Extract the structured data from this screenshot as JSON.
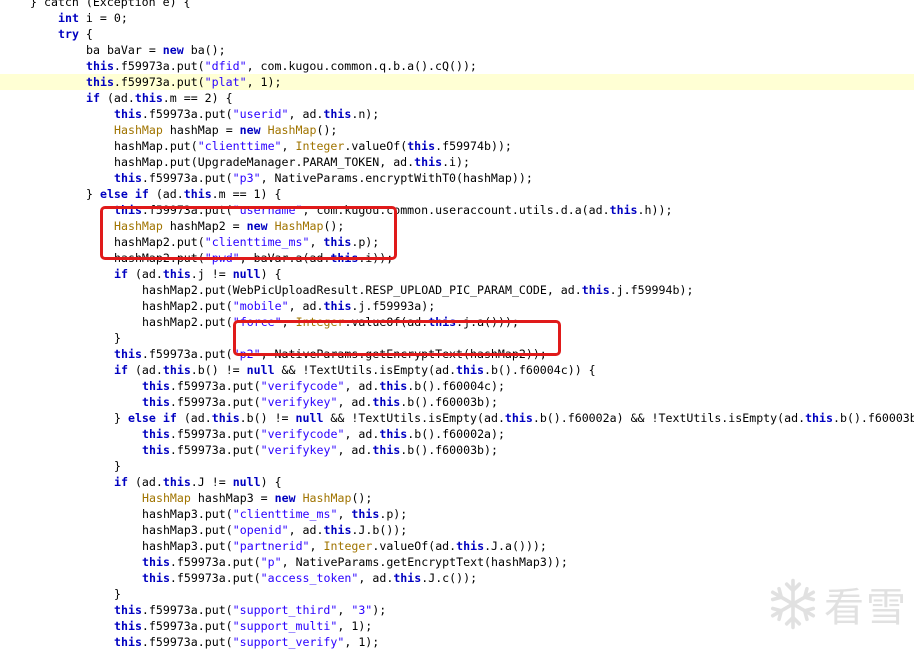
{
  "colors": {
    "keyword": "#0000c0",
    "type": "#a07400",
    "string": "#2a00ff",
    "highlight_line": "#ffffd4",
    "annotation_box": "#e01a1a"
  },
  "code_lines": [
    {
      "indent": 0,
      "hl": false,
      "tokens": [
        [
          "n",
          "} catch (Exception e) {"
        ]
      ]
    },
    {
      "indent": 1,
      "hl": false,
      "tokens": [
        [
          "k",
          "int"
        ],
        [
          "n",
          " i = 0;"
        ]
      ]
    },
    {
      "indent": 1,
      "hl": false,
      "tokens": [
        [
          "k",
          "try"
        ],
        [
          "n",
          " {"
        ]
      ]
    },
    {
      "indent": 2,
      "hl": false,
      "tokens": [
        [
          "n",
          "ba baVar = "
        ],
        [
          "k",
          "new"
        ],
        [
          "n",
          " ba();"
        ]
      ]
    },
    {
      "indent": 2,
      "hl": false,
      "tokens": [
        [
          "k",
          "this"
        ],
        [
          "n",
          ".f59973a.put("
        ],
        [
          "s",
          "\"dfid\""
        ],
        [
          "n",
          ", com.kugou.common.q.b.a().cQ());"
        ]
      ]
    },
    {
      "indent": 2,
      "hl": true,
      "tokens": [
        [
          "k",
          "this"
        ],
        [
          "n",
          ".f59973a.put("
        ],
        [
          "s",
          "\"plat\""
        ],
        [
          "n",
          ", 1);"
        ]
      ]
    },
    {
      "indent": 2,
      "hl": false,
      "tokens": [
        [
          "k",
          "if"
        ],
        [
          "n",
          " (ad."
        ],
        [
          "k",
          "this"
        ],
        [
          "n",
          ".m == 2) {"
        ]
      ]
    },
    {
      "indent": 3,
      "hl": false,
      "tokens": [
        [
          "k",
          "this"
        ],
        [
          "n",
          ".f59973a.put("
        ],
        [
          "s",
          "\"userid\""
        ],
        [
          "n",
          ", ad."
        ],
        [
          "k",
          "this"
        ],
        [
          "n",
          ".n);"
        ]
      ]
    },
    {
      "indent": 3,
      "hl": false,
      "tokens": [
        [
          "t",
          "HashMap"
        ],
        [
          "n",
          " hashMap = "
        ],
        [
          "k",
          "new"
        ],
        [
          "n",
          " "
        ],
        [
          "t",
          "HashMap"
        ],
        [
          "n",
          "();"
        ]
      ]
    },
    {
      "indent": 3,
      "hl": false,
      "tokens": [
        [
          "n",
          "hashMap.put("
        ],
        [
          "s",
          "\"clienttime\""
        ],
        [
          "n",
          ", "
        ],
        [
          "t",
          "Integer"
        ],
        [
          "n",
          ".valueOf("
        ],
        [
          "k",
          "this"
        ],
        [
          "n",
          ".f59974b));"
        ]
      ]
    },
    {
      "indent": 3,
      "hl": false,
      "tokens": [
        [
          "n",
          "hashMap.put(UpgradeManager.PARAM_TOKEN, ad."
        ],
        [
          "k",
          "this"
        ],
        [
          "n",
          ".i);"
        ]
      ]
    },
    {
      "indent": 3,
      "hl": false,
      "tokens": [
        [
          "k",
          "this"
        ],
        [
          "n",
          ".f59973a.put("
        ],
        [
          "s",
          "\"p3\""
        ],
        [
          "n",
          ", NativeParams.encryptWithT0(hashMap));"
        ]
      ]
    },
    {
      "indent": 2,
      "hl": false,
      "tokens": [
        [
          "n",
          "} "
        ],
        [
          "k",
          "else if"
        ],
        [
          "n",
          " (ad."
        ],
        [
          "k",
          "this"
        ],
        [
          "n",
          ".m == 1) {"
        ]
      ]
    },
    {
      "indent": 3,
      "hl": false,
      "tokens": [
        [
          "k",
          "this"
        ],
        [
          "n",
          ".f59973a.put("
        ],
        [
          "s",
          "\"username\""
        ],
        [
          "n",
          ", com.kugou.common.useraccount.utils.d.a(ad."
        ],
        [
          "k",
          "this"
        ],
        [
          "n",
          ".h));"
        ]
      ]
    },
    {
      "indent": 3,
      "hl": false,
      "tokens": [
        [
          "t",
          "HashMap"
        ],
        [
          "n",
          " hashMap2 = "
        ],
        [
          "k",
          "new"
        ],
        [
          "n",
          " "
        ],
        [
          "t",
          "HashMap"
        ],
        [
          "n",
          "();"
        ]
      ]
    },
    {
      "indent": 3,
      "hl": false,
      "tokens": [
        [
          "n",
          "hashMap2.put("
        ],
        [
          "s",
          "\"clienttime_ms\""
        ],
        [
          "n",
          ", "
        ],
        [
          "k",
          "this"
        ],
        [
          "n",
          ".p);"
        ]
      ]
    },
    {
      "indent": 3,
      "hl": false,
      "tokens": [
        [
          "n",
          "hashMap2.put("
        ],
        [
          "s",
          "\"pwd\""
        ],
        [
          "n",
          ", baVar.a(ad."
        ],
        [
          "k",
          "this"
        ],
        [
          "n",
          ".i));"
        ]
      ]
    },
    {
      "indent": 3,
      "hl": false,
      "tokens": [
        [
          "k",
          "if"
        ],
        [
          "n",
          " (ad."
        ],
        [
          "k",
          "this"
        ],
        [
          "n",
          ".j != "
        ],
        [
          "k",
          "null"
        ],
        [
          "n",
          ") {"
        ]
      ]
    },
    {
      "indent": 4,
      "hl": false,
      "tokens": [
        [
          "n",
          "hashMap2.put(WebPicUploadResult.RESP_UPLOAD_PIC_PARAM_CODE, ad."
        ],
        [
          "k",
          "this"
        ],
        [
          "n",
          ".j.f59994b);"
        ]
      ]
    },
    {
      "indent": 4,
      "hl": false,
      "tokens": [
        [
          "n",
          "hashMap2.put("
        ],
        [
          "s",
          "\"mobile\""
        ],
        [
          "n",
          ", ad."
        ],
        [
          "k",
          "this"
        ],
        [
          "n",
          ".j.f59993a);"
        ]
      ]
    },
    {
      "indent": 4,
      "hl": false,
      "tokens": [
        [
          "n",
          "hashMap2.put("
        ],
        [
          "s",
          "\"force\""
        ],
        [
          "n",
          ", "
        ],
        [
          "t",
          "Integer"
        ],
        [
          "n",
          ".valueOf(ad."
        ],
        [
          "k",
          "this"
        ],
        [
          "n",
          ".j.a()));"
        ]
      ]
    },
    {
      "indent": 3,
      "hl": false,
      "tokens": [
        [
          "n",
          "}"
        ]
      ]
    },
    {
      "indent": 3,
      "hl": false,
      "tokens": [
        [
          "k",
          "this"
        ],
        [
          "n",
          ".f59973a.put("
        ],
        [
          "s",
          "\"p2\""
        ],
        [
          "n",
          ", NativeParams.getEncryptText(hashMap2));"
        ]
      ]
    },
    {
      "indent": 3,
      "hl": false,
      "tokens": [
        [
          "k",
          "if"
        ],
        [
          "n",
          " (ad."
        ],
        [
          "k",
          "this"
        ],
        [
          "n",
          ".b() != "
        ],
        [
          "k",
          "null"
        ],
        [
          "n",
          " && !TextUtils.isEmpty(ad."
        ],
        [
          "k",
          "this"
        ],
        [
          "n",
          ".b().f60004c)) {"
        ]
      ]
    },
    {
      "indent": 4,
      "hl": false,
      "tokens": [
        [
          "k",
          "this"
        ],
        [
          "n",
          ".f59973a.put("
        ],
        [
          "s",
          "\"verifycode\""
        ],
        [
          "n",
          ", ad."
        ],
        [
          "k",
          "this"
        ],
        [
          "n",
          ".b().f60004c);"
        ]
      ]
    },
    {
      "indent": 4,
      "hl": false,
      "tokens": [
        [
          "k",
          "this"
        ],
        [
          "n",
          ".f59973a.put("
        ],
        [
          "s",
          "\"verifykey\""
        ],
        [
          "n",
          ", ad."
        ],
        [
          "k",
          "this"
        ],
        [
          "n",
          ".b().f60003b);"
        ]
      ]
    },
    {
      "indent": 3,
      "hl": false,
      "tokens": [
        [
          "n",
          "} "
        ],
        [
          "k",
          "else if"
        ],
        [
          "n",
          " (ad."
        ],
        [
          "k",
          "this"
        ],
        [
          "n",
          ".b() != "
        ],
        [
          "k",
          "null"
        ],
        [
          "n",
          " && !TextUtils.isEmpty(ad."
        ],
        [
          "k",
          "this"
        ],
        [
          "n",
          ".b().f60002a) && !TextUtils.isEmpty(ad."
        ],
        [
          "k",
          "this"
        ],
        [
          "n",
          ".b().f60003b"
        ]
      ]
    },
    {
      "indent": 4,
      "hl": false,
      "tokens": [
        [
          "k",
          "this"
        ],
        [
          "n",
          ".f59973a.put("
        ],
        [
          "s",
          "\"verifycode\""
        ],
        [
          "n",
          ", ad."
        ],
        [
          "k",
          "this"
        ],
        [
          "n",
          ".b().f60002a);"
        ]
      ]
    },
    {
      "indent": 4,
      "hl": false,
      "tokens": [
        [
          "k",
          "this"
        ],
        [
          "n",
          ".f59973a.put("
        ],
        [
          "s",
          "\"verifykey\""
        ],
        [
          "n",
          ", ad."
        ],
        [
          "k",
          "this"
        ],
        [
          "n",
          ".b().f60003b);"
        ]
      ]
    },
    {
      "indent": 3,
      "hl": false,
      "tokens": [
        [
          "n",
          "}"
        ]
      ]
    },
    {
      "indent": 3,
      "hl": false,
      "tokens": [
        [
          "k",
          "if"
        ],
        [
          "n",
          " (ad."
        ],
        [
          "k",
          "this"
        ],
        [
          "n",
          ".J != "
        ],
        [
          "k",
          "null"
        ],
        [
          "n",
          ") {"
        ]
      ]
    },
    {
      "indent": 4,
      "hl": false,
      "tokens": [
        [
          "t",
          "HashMap"
        ],
        [
          "n",
          " hashMap3 = "
        ],
        [
          "k",
          "new"
        ],
        [
          "n",
          " "
        ],
        [
          "t",
          "HashMap"
        ],
        [
          "n",
          "();"
        ]
      ]
    },
    {
      "indent": 4,
      "hl": false,
      "tokens": [
        [
          "n",
          "hashMap3.put("
        ],
        [
          "s",
          "\"clienttime_ms\""
        ],
        [
          "n",
          ", "
        ],
        [
          "k",
          "this"
        ],
        [
          "n",
          ".p);"
        ]
      ]
    },
    {
      "indent": 4,
      "hl": false,
      "tokens": [
        [
          "n",
          "hashMap3.put("
        ],
        [
          "s",
          "\"openid\""
        ],
        [
          "n",
          ", ad."
        ],
        [
          "k",
          "this"
        ],
        [
          "n",
          ".J.b());"
        ]
      ]
    },
    {
      "indent": 4,
      "hl": false,
      "tokens": [
        [
          "n",
          "hashMap3.put("
        ],
        [
          "s",
          "\"partnerid\""
        ],
        [
          "n",
          ", "
        ],
        [
          "t",
          "Integer"
        ],
        [
          "n",
          ".valueOf(ad."
        ],
        [
          "k",
          "this"
        ],
        [
          "n",
          ".J.a()));"
        ]
      ]
    },
    {
      "indent": 4,
      "hl": false,
      "tokens": [
        [
          "k",
          "this"
        ],
        [
          "n",
          ".f59973a.put("
        ],
        [
          "s",
          "\"p\""
        ],
        [
          "n",
          ", NativeParams.getEncryptText(hashMap3));"
        ]
      ]
    },
    {
      "indent": 4,
      "hl": false,
      "tokens": [
        [
          "k",
          "this"
        ],
        [
          "n",
          ".f59973a.put("
        ],
        [
          "s",
          "\"access_token\""
        ],
        [
          "n",
          ", ad."
        ],
        [
          "k",
          "this"
        ],
        [
          "n",
          ".J.c());"
        ]
      ]
    },
    {
      "indent": 3,
      "hl": false,
      "tokens": [
        [
          "n",
          "}"
        ]
      ]
    },
    {
      "indent": 3,
      "hl": false,
      "tokens": [
        [
          "k",
          "this"
        ],
        [
          "n",
          ".f59973a.put("
        ],
        [
          "s",
          "\"support_third\""
        ],
        [
          "n",
          ", "
        ],
        [
          "s",
          "\"3\""
        ],
        [
          "n",
          ");"
        ]
      ]
    },
    {
      "indent": 3,
      "hl": false,
      "tokens": [
        [
          "k",
          "this"
        ],
        [
          "n",
          ".f59973a.put("
        ],
        [
          "s",
          "\"support_multi\""
        ],
        [
          "n",
          ", 1);"
        ]
      ]
    },
    {
      "indent": 3,
      "hl": false,
      "tokens": [
        [
          "k",
          "this"
        ],
        [
          "n",
          ".f59973a.put("
        ],
        [
          "s",
          "\"support_verify\""
        ],
        [
          "n",
          ", 1);"
        ]
      ]
    }
  ],
  "watermark": {
    "icon": "snowflake-icon",
    "text": "看雪"
  }
}
